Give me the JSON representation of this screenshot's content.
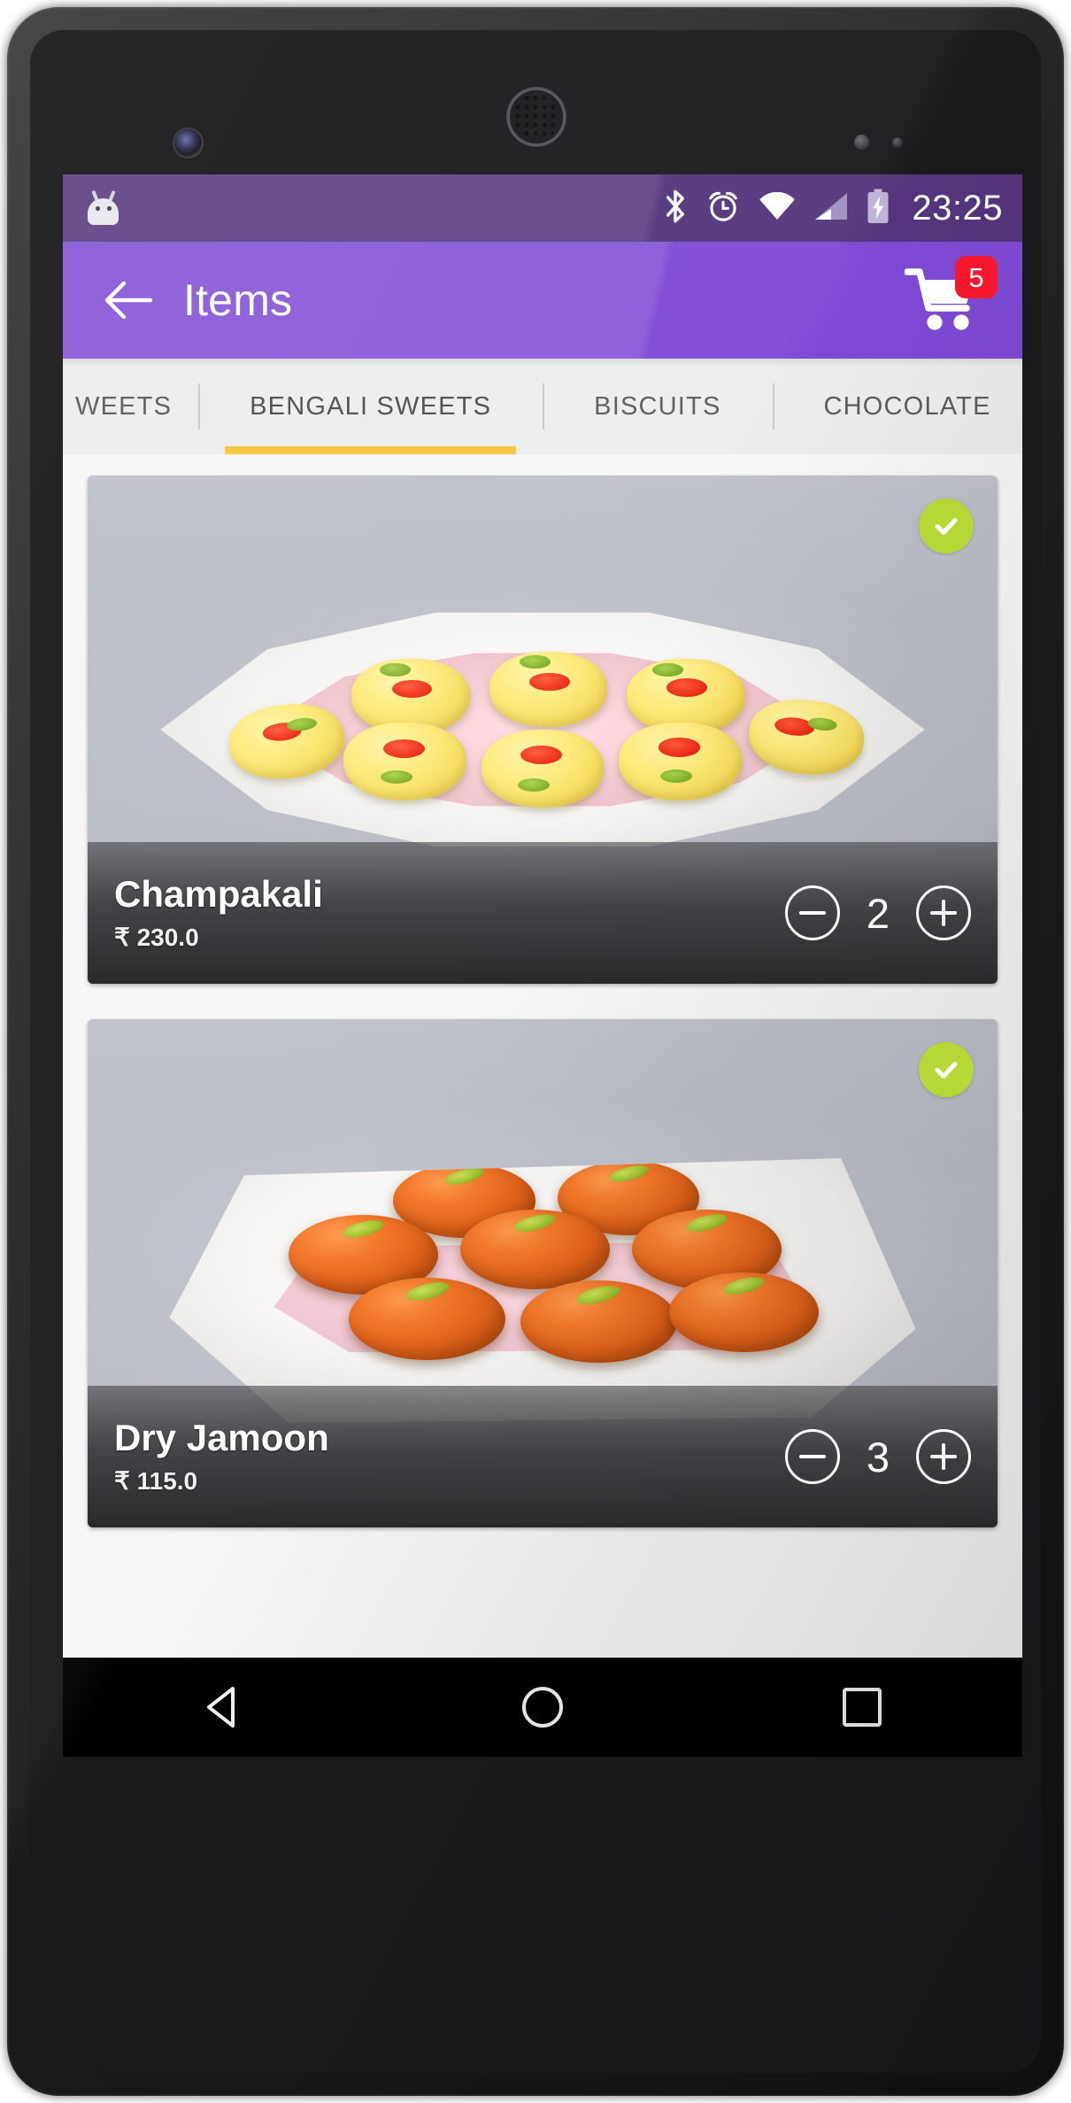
{
  "status_bar": {
    "icons": [
      "android-head-icon",
      "bluetooth-icon",
      "alarm-clock-icon",
      "wifi-icon",
      "cell-signal-icon",
      "battery-charging-icon"
    ],
    "time": "23:25",
    "background_color": "#54357d"
  },
  "app_bar": {
    "back_label": "back-arrow",
    "title": "Items",
    "cart_badge_count": "5",
    "background_color": "#7e49d4",
    "badge_color": "#f5182c"
  },
  "tabs": {
    "items": [
      {
        "label": "WEETS",
        "active": false
      },
      {
        "label": "BENGALI SWEETS",
        "active": true
      },
      {
        "label": "BISCUITS",
        "active": false
      },
      {
        "label": "CHOCOLATE",
        "active": false
      }
    ],
    "indicator_color": "#f9c537",
    "background_color": "#eceded"
  },
  "items": [
    {
      "name": "Champakali",
      "price": "₹ 230.0",
      "quantity": "2",
      "selected": true,
      "decrement_label": "decrease-quantity",
      "increment_label": "increase-quantity",
      "image_alt": "champakali-sweets-photo"
    },
    {
      "name": "Dry Jamoon",
      "price": "₹ 115.0",
      "quantity": "3",
      "selected": true,
      "decrement_label": "decrease-quantity",
      "increment_label": "increase-quantity",
      "image_alt": "dry-jamoon-sweets-photo"
    }
  ],
  "nav_bar": {
    "buttons": [
      "back-triangle-icon",
      "home-circle-icon",
      "recents-square-icon"
    ],
    "background_color": "#000000"
  },
  "colors": {
    "accent_purple": "#7e49d4",
    "status_purple": "#54357d",
    "tab_indicator": "#f9c537",
    "badge_red": "#f5182c",
    "check_green": "#b6d836",
    "page_background": "#f7f7f7"
  }
}
